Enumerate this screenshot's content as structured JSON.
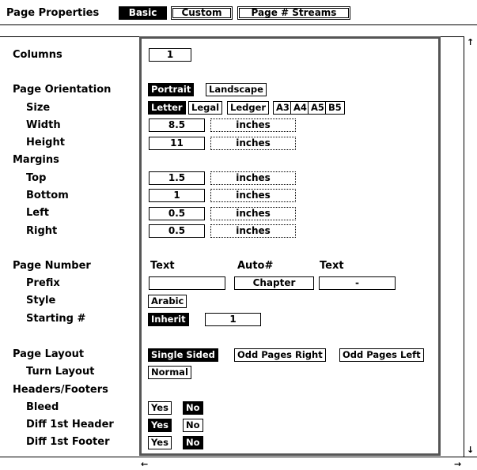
{
  "title_bar": {
    "title": "Page Properties",
    "tabs": [
      "Basic",
      "Custom",
      "Page # Streams"
    ]
  },
  "labels": {
    "columns": "Columns",
    "page_orientation": "Page Orientation",
    "size": "Size",
    "width": "Width",
    "height": "Height",
    "margins": "Margins",
    "top": "Top",
    "bottom": "Bottom",
    "left": "Left",
    "right": "Right",
    "page_number": "Page Number",
    "prefix": "Prefix",
    "style": "Style",
    "starting": "Starting #",
    "page_layout": "Page Layout",
    "turn_layout": "Turn Layout",
    "headers_footers": "Headers/Footers",
    "bleed": "Bleed",
    "diff_1st_header": "Diff 1st Header",
    "diff_1st_footer": "Diff 1st Footer"
  },
  "values": {
    "columns": "1",
    "width": "8.5",
    "height": "11",
    "top": "1.5",
    "bottom": "1",
    "left": "0.5",
    "right": "0.5",
    "unit": "inches",
    "starting": "1"
  },
  "orientation": {
    "portrait": "Portrait",
    "landscape": "Landscape",
    "selected": "Portrait"
  },
  "sizes": [
    "Letter",
    "Legal",
    "Ledger",
    "A3",
    "A4",
    "A5",
    "B5"
  ],
  "page_number": {
    "col_text": "Text",
    "col_auto": "Auto#",
    "col_text2": "Text",
    "prefix_text": "",
    "prefix_auto": "Chapter",
    "prefix_sep": "-",
    "style": "Arabic",
    "inherit": "Inherit"
  },
  "layout": {
    "options": [
      "Single Sided",
      "Odd Pages Right",
      "Odd Pages Left"
    ],
    "turn": "Normal"
  },
  "yesno": {
    "yes": "Yes",
    "no": "No"
  },
  "scroll": {
    "up": "↑",
    "down": "↓",
    "left": "←",
    "right": "→"
  }
}
